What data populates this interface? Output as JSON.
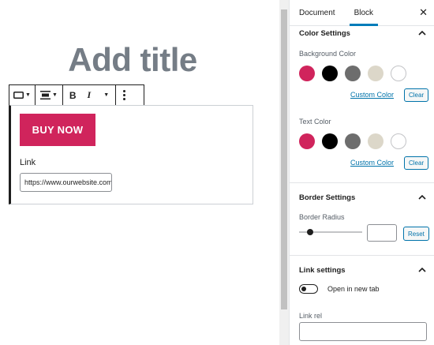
{
  "editor": {
    "title_placeholder": "Add title",
    "button_text": "BUY NOW",
    "link_label": "Link",
    "link_value": "https://www.ourwebsite.com"
  },
  "toolbar": {
    "icons": [
      "block-type-icon",
      "align-icon",
      "bold-icon",
      "italic-icon",
      "more-options-icon"
    ],
    "bold": "B",
    "italic": "I"
  },
  "sidebar": {
    "tabs": [
      {
        "label": "Document",
        "active": false
      },
      {
        "label": "Block",
        "active": true
      }
    ],
    "close_symbol": "✕",
    "color_settings": {
      "title": "Color Settings",
      "background_label": "Background Color",
      "text_label": "Text Color",
      "palette": [
        "#d0245c",
        "#000000",
        "#6d6d6d",
        "#dcd7c9",
        "#ffffff"
      ],
      "custom_color_label": "Custom Color",
      "clear_label": "Clear"
    },
    "border_settings": {
      "title": "Border Settings",
      "radius_label": "Border Radius",
      "reset_label": "Reset"
    },
    "link_settings": {
      "title": "Link settings",
      "new_tab_label": "Open in new tab",
      "new_tab_enabled": false,
      "rel_label": "Link rel"
    }
  }
}
